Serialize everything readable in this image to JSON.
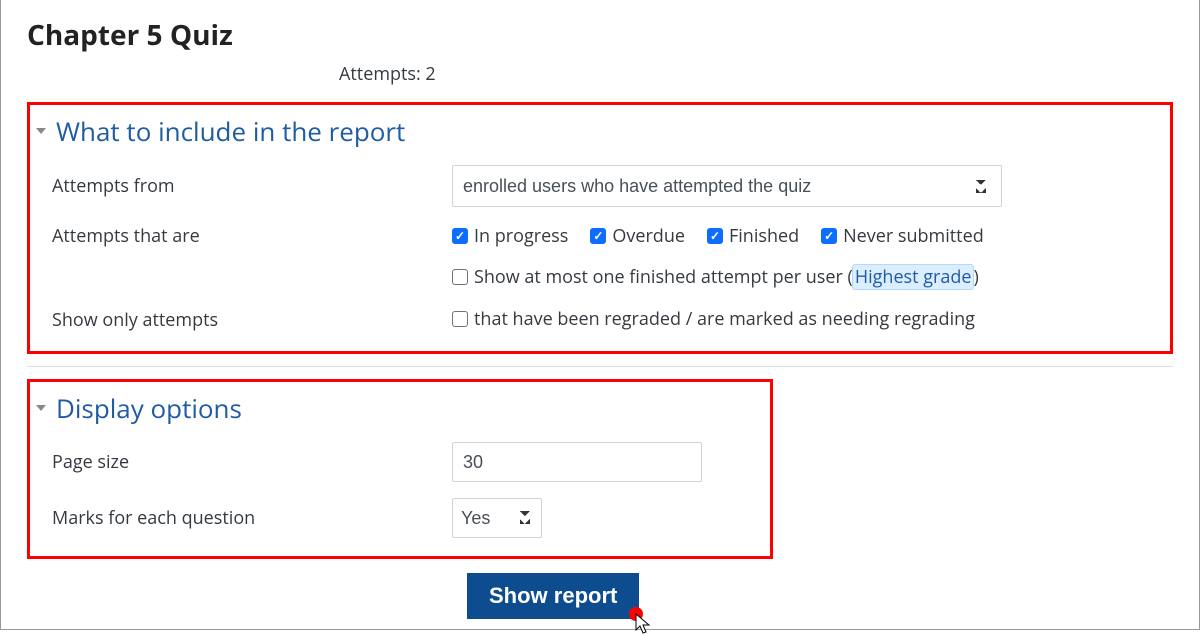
{
  "page_title": "Chapter 5 Quiz",
  "attempts_line": "Attempts: 2",
  "section1": {
    "heading": "What to include in the report",
    "attempts_from": {
      "label": "Attempts from",
      "selected": "enrolled users who have attempted the quiz"
    },
    "attempts_that_are": {
      "label": "Attempts that are",
      "options": [
        {
          "label": "In progress",
          "checked": true
        },
        {
          "label": "Overdue",
          "checked": true
        },
        {
          "label": "Finished",
          "checked": true
        },
        {
          "label": "Never submitted",
          "checked": true
        }
      ],
      "one_per_user": {
        "checked": false,
        "text": "Show at most one finished attempt per user",
        "paren_open": "(",
        "link": "Highest grade",
        "paren_close": ")"
      }
    },
    "show_only": {
      "label": "Show only attempts",
      "option": {
        "checked": false,
        "text": "that have been regraded / are marked as needing regrading"
      }
    }
  },
  "section2": {
    "heading": "Display options",
    "page_size": {
      "label": "Page size",
      "value": "30"
    },
    "marks": {
      "label": "Marks for each question",
      "value": "Yes"
    }
  },
  "submit_label": "Show report"
}
